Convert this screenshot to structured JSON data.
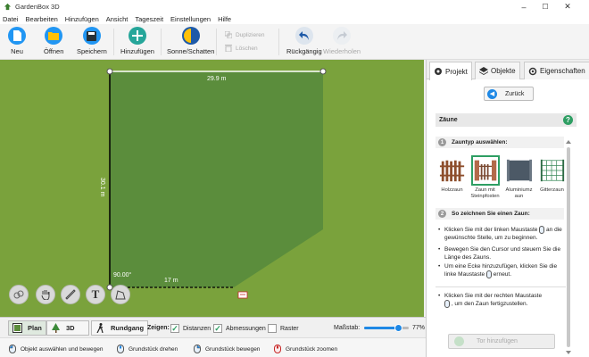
{
  "window": {
    "title": "GardenBox 3D",
    "minimize": "–",
    "maximize": "☐",
    "close": "✕"
  },
  "menu": [
    "Datei",
    "Bearbeiten",
    "Hinzufügen",
    "Ansicht",
    "Tageszeit",
    "Einstellungen",
    "Hilfe"
  ],
  "toolbar": {
    "new": "Neu",
    "open": "Öffnen",
    "save": "Speichern",
    "add": "Hinzufügen",
    "sun_shadow": "Sonne/Schatten",
    "duplicate": "Duplizieren",
    "delete": "Löschen",
    "undo": "Rückgängig",
    "redo": "Wiederholen"
  },
  "canvas": {
    "top_dim": "29.9 m",
    "left_dim": "30.1 m",
    "angle": "90.00°",
    "bottom_dim": "17 m"
  },
  "panel": {
    "tabs": {
      "project": "Projekt",
      "objects": "Objekte",
      "properties": "Eigenschaften"
    },
    "back": "Zurück",
    "section_title": "Zäune",
    "help": "?",
    "step1_num": "1",
    "step1": "Zauntyp auswählen:",
    "fences": [
      {
        "label": "Holzzaun"
      },
      {
        "label": "Zaun mit Steinpfosten"
      },
      {
        "label": "Aluminiumz aun"
      },
      {
        "label": "Gitterzaun"
      }
    ],
    "step2_num": "2",
    "step2": "So zeichnen Sie einen Zaun:",
    "instr1a": "Klicken Sie mit der linken Maustaste",
    "instr1b": "an die gewünschte Stelle, um zu beginnen.",
    "instr2": "Bewegen Sie den Cursor und steuern Sie die Länge des Zauns.",
    "instr3a": "Um eine Ecke hinzuzufügen, klicken Sie die linke Maustaste",
    "instr3b": "erneut.",
    "instr4a": "Klicken Sie mit der rechten Maustaste",
    "instr4b": ", um den Zaun fertigzustellen.",
    "add_button": "Tor hinzufügen"
  },
  "bottom": {
    "plan": "Plan",
    "view3d": "3D",
    "walk": "Rundgang",
    "show": "Zeigen:",
    "distances": "Distanzen",
    "dimensions": "Abmessungen",
    "grid": "Raster",
    "scale_label": "Maßstab:",
    "scale_value": "77%",
    "distances_checked": true,
    "dimensions_checked": true,
    "grid_checked": false,
    "scale_level": 0.77
  },
  "status": {
    "select": "Objekt auswählen und bewegen",
    "rotate": "Grundstück drehen",
    "move": "Grundstück bewegen",
    "zoom": "Grundstück zoomen"
  },
  "colors": {
    "accent": "#1e88e5",
    "green": "#2e9e63",
    "lawn": "#7aa23c",
    "plot": "#5b8d3c"
  }
}
